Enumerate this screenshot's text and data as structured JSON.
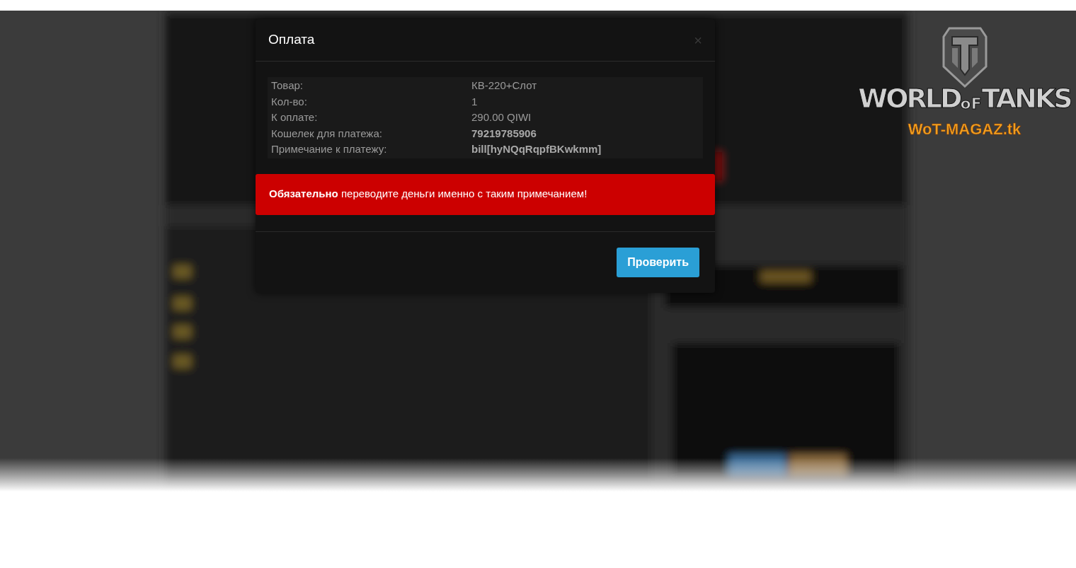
{
  "logo": {
    "words": [
      "WORLD",
      "oF",
      "TANKS"
    ],
    "site": "WoT-MAGAZ.tk"
  },
  "dialog": {
    "title": "Оплата",
    "close": "×",
    "details": [
      {
        "label": "Товар:",
        "value": "КВ-220+Слот",
        "bold": false
      },
      {
        "label": "Кол-во:",
        "value": "1",
        "bold": false
      },
      {
        "label": "К оплате:",
        "value": "290.00 QIWI",
        "bold": false
      },
      {
        "label": "Кошелек для платежа:",
        "value": "79219785906",
        "bold": true
      },
      {
        "label": "Примечание к платежу:",
        "value": "bill[hyNQqRqpfBKwkmm]",
        "bold": true
      }
    ],
    "alert": "**Обязательно** переводите деньги именно с таким примечанием!",
    "button": "Проверить"
  }
}
